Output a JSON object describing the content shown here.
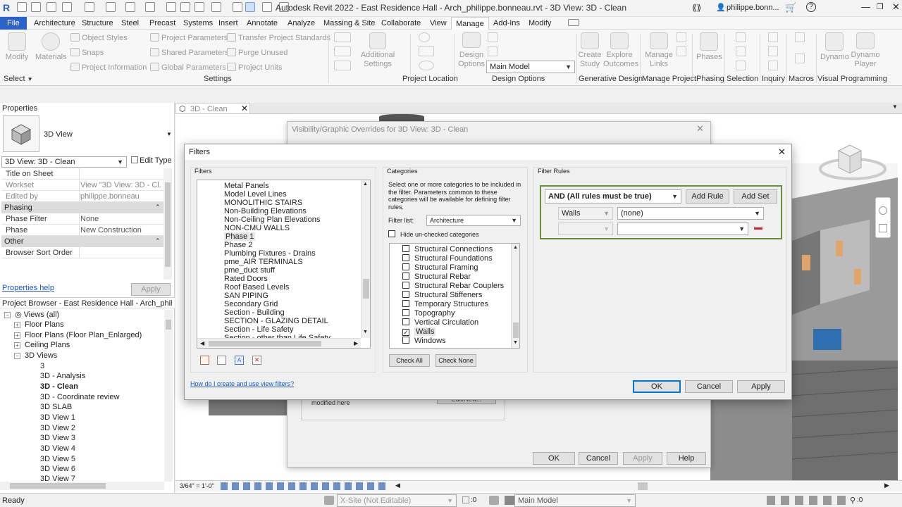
{
  "app": {
    "title": "Autodesk Revit 2022 - East Residence Hall - Arch_philippe.bonneau.rvt - 3D View: 3D - Clean",
    "user": "philippe.bonn..."
  },
  "menu": {
    "tabs": [
      "File",
      "Architecture",
      "Structure",
      "Steel",
      "Precast",
      "Systems",
      "Insert",
      "Annotate",
      "Analyze",
      "Massing & Site",
      "Collaborate",
      "View",
      "Manage",
      "Add-Ins",
      "Modify"
    ],
    "active": "Manage"
  },
  "ribbon": {
    "modify": "Modify",
    "select": "Select",
    "materials": "Materials",
    "settings_small": [
      "Object Styles",
      "Snaps",
      "Project Information",
      "Project Parameters",
      "Shared Parameters",
      "Global Parameters",
      "Transfer Project Standards",
      "Purge Unused",
      "Project Units"
    ],
    "additional_settings": "Additional Settings",
    "design_options": "Design Options",
    "main_model": "Main Model",
    "create_study": "Create Study",
    "explore_outcomes": "Explore Outcomes",
    "manage_links": "Manage Links",
    "phases": "Phases",
    "dynamo": "Dynamo",
    "dynamo_player": "Dynamo Player",
    "panels": [
      "Settings",
      "Project Location",
      "Design Options",
      "Generative Design",
      "Manage Project",
      "Phasing",
      "Selection",
      "Inquiry",
      "Macros",
      "Visual Programming"
    ]
  },
  "properties": {
    "title": "Properties",
    "type": "3D View",
    "selector": "3D View: 3D - Clean",
    "edit_type": "Edit Type",
    "rows": [
      {
        "k": "Title on Sheet",
        "v": ""
      },
      {
        "k": "Workset",
        "v": "View \"3D View: 3D - Cl..."
      },
      {
        "k": "Edited by",
        "v": "philippe.bonneau"
      }
    ],
    "phasing": "Phasing",
    "phase_rows": [
      {
        "k": "Phase Filter",
        "v": "None"
      },
      {
        "k": "Phase",
        "v": "New Construction"
      }
    ],
    "other": "Other",
    "other_rows": [
      {
        "k": "Browser Sort Order",
        "v": ""
      }
    ],
    "help": "Properties help",
    "apply": "Apply"
  },
  "browser": {
    "title": "Project Browser - East Residence Hall - Arch_philippe...",
    "root": "Views (all)",
    "groups": [
      "Floor Plans",
      "Floor Plans (Floor Plan_Enlarged)",
      "Ceiling Plans",
      "3D Views"
    ],
    "views": [
      "3",
      "3D - Analysis",
      "3D - Clean",
      "3D - Coordinate review",
      "3D SLAB",
      "3D View 1",
      "3D View 2",
      "3D View 3",
      "3D View 4",
      "3D View 5",
      "3D View 6",
      "3D View 7"
    ],
    "active_view": "3D - Clean"
  },
  "viewtab": {
    "label": "3D - Clean"
  },
  "vg_dialog": {
    "title": "Visibility/Graphic Overrides for 3D View: 3D - Clean",
    "modified": "modified here",
    "edit_new": "Edit/New...",
    "ok": "OK",
    "cancel": "Cancel",
    "apply": "Apply",
    "help": "Help"
  },
  "filters": {
    "title": "Filters",
    "filters_label": "Filters",
    "items": [
      "Metal Panels",
      "Model Level Lines",
      "MONOLITHIC STAIRS",
      "Non-Building Elevations",
      "Non-Ceiling Plan Elevations",
      "NON-CMU WALLS",
      "Phase 1",
      "Phase 2",
      "Plumbing Fixtures - Drains",
      "pme_AIR TERMINALS",
      "pme_duct stuff",
      "Rated Doors",
      "Roof Based Levels",
      "SAN PIPING",
      "Secondary Grid",
      "Section - Building",
      "SECTION - GLAZING DETAIL",
      "Section - Life Safety",
      "Section - other than Life Safety"
    ],
    "selected": "Phase 1",
    "categories_label": "Categories",
    "categories_desc": "Select one or more categories to be included in the filter.  Parameters common to these categories will be available for defining filter rules.",
    "filter_list_label": "Filter list:",
    "filter_list_value": "Architecture",
    "hide_unchecked": "Hide un-checked categories",
    "categories": [
      {
        "name": "Structural Connections",
        "checked": false
      },
      {
        "name": "Structural Foundations",
        "checked": false
      },
      {
        "name": "Structural Framing",
        "checked": false
      },
      {
        "name": "Structural Rebar",
        "checked": false
      },
      {
        "name": "Structural Rebar Couplers",
        "checked": false
      },
      {
        "name": "Structural Stiffeners",
        "checked": false
      },
      {
        "name": "Temporary Structures",
        "checked": false
      },
      {
        "name": "Topography",
        "checked": false
      },
      {
        "name": "Vertical Circulation",
        "checked": false
      },
      {
        "name": "Walls",
        "checked": true
      },
      {
        "name": "Windows",
        "checked": false
      }
    ],
    "check_all": "Check All",
    "check_none": "Check None",
    "rules_label": "Filter Rules",
    "and_rule": "AND (All rules must be true)",
    "add_rule": "Add Rule",
    "add_set": "Add Set",
    "rule_category": "Walls",
    "rule_param": "(none)",
    "help_link": "How do I create and use view filters?",
    "ok": "OK",
    "cancel": "Cancel",
    "apply": "Apply"
  },
  "viewctrl": {
    "scale": "3/64\" = 1'-0\""
  },
  "status": {
    "ready": "Ready",
    "workset": "X-Site (Not Editable)",
    "count": ":0",
    "model": "Main Model",
    "filter_count": ":0"
  },
  "colors": {
    "accent": "#2a62c9",
    "rule_border": "#6b8e3a",
    "remove": "#cc2222"
  }
}
